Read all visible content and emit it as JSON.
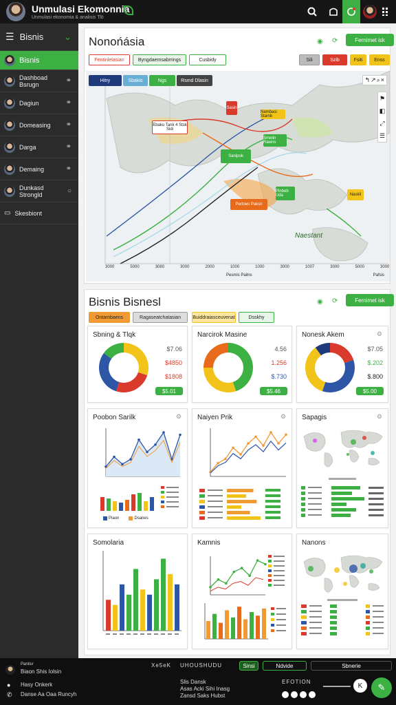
{
  "app": {
    "title": "Unmulasi Ekomonnia",
    "subtitle": "Unmulasi ekonomia & analisis Ti̇̇ö"
  },
  "colors": {
    "accent": "#3cb043",
    "dark": "#161616",
    "sidebar": "#2b2b2b",
    "red": "#d93a2b",
    "yellow": "#f2c318",
    "blue": "#2d56a6"
  },
  "topbar_icons": [
    "search-icon",
    "chat-icon",
    "refresh-icon",
    "avatar",
    "grid-icon"
  ],
  "sidebar": {
    "header": "Bisnis",
    "items": [
      {
        "label": "Bisnis",
        "active": true
      },
      {
        "label": "Dashboad Bsrugn"
      },
      {
        "label": "Dagiun"
      },
      {
        "label": "Domeasing"
      },
      {
        "label": "Darga"
      },
      {
        "label": "Demaing"
      },
      {
        "label": "Dunkasd Strongld"
      },
      {
        "label": "Skesbiont"
      }
    ]
  },
  "map_panel": {
    "title": "Nonońásia",
    "action": "Fernimet isk",
    "filters": [
      "Fentinlelasian",
      "Byngdaemsabrrings",
      "Cusbidy"
    ],
    "toggles": [
      "Hitry",
      "Sbakis",
      "Ngs",
      "Rsmd Dlasin"
    ],
    "buttons": [
      "Sili",
      "Szib",
      "Fsiti",
      "Enss"
    ],
    "callouts": [
      "Sasin",
      "Ebaku Tank 4 Stsk Sidi",
      "Nambasi Stamb",
      "Smelin Rawns",
      "Sanipok",
      "Pertoes Paksir",
      "Pinbeb Uda",
      "Naskil"
    ],
    "region_label": "Naestant",
    "x_ticks": [
      "3000",
      "5000",
      "3080",
      "3000",
      "2000",
      "1000",
      "1000",
      "3000",
      "1007",
      "3000",
      "5000",
      "3000"
    ],
    "x_label": "Pesmis Pailns",
    "x_unit": "Pafsis"
  },
  "business_panel": {
    "title": "Bisnis Bisnesl",
    "action": "Fernimet isk",
    "filters": [
      "Ontambaens",
      "Ragaseatchatasian",
      "Buiddraiasceuvenat",
      "Dsskhy"
    ]
  },
  "charts": [
    {
      "title": "Sbning & Tlqk",
      "type": "donut",
      "values": [
        "$7.06",
        "$4850",
        "$1808"
      ],
      "badge": "$5.01",
      "chart_data": {
        "type": "pie",
        "values": [
          30,
          25,
          30,
          15
        ],
        "colors": [
          "#f2c318",
          "#d93a2b",
          "#2d56a6",
          "#3cb043"
        ]
      }
    },
    {
      "title": "Narcirok Masine",
      "type": "donut",
      "values": [
        "4.56",
        "1.256",
        "$.730"
      ],
      "badge": "$5.46",
      "chart_data": {
        "type": "pie",
        "values": [
          45,
          30,
          25
        ],
        "colors": [
          "#3cb043",
          "#f2c318",
          "#e86a1b"
        ]
      }
    },
    {
      "title": "Nonesk Akem",
      "type": "donut",
      "values": [
        "$7.05",
        "$.202",
        "$.800"
      ],
      "badge": "$5.00",
      "chart_data": {
        "type": "pie",
        "values": [
          20,
          35,
          35,
          10
        ],
        "colors": [
          "#d93a2b",
          "#2d56a6",
          "#f2c318",
          "#1f3a7a"
        ]
      }
    },
    {
      "title": "Poobon Sarilk",
      "type": "line",
      "legend": [
        "Piaon",
        "Dsanes"
      ],
      "chart_data": {
        "type": "line",
        "y": [
          2,
          4,
          2.5,
          3.5,
          7.5,
          5,
          6.5,
          9,
          3.5,
          8.5
        ]
      },
      "bars": [
        20,
        18,
        14,
        12,
        16,
        24,
        26,
        14,
        20
      ]
    },
    {
      "title": "Naiyen Prik",
      "type": "line",
      "chart_data": {
        "type": "line",
        "y": [
          1,
          3,
          4,
          6.5,
          5,
          7.5,
          9,
          7,
          10,
          7.5,
          9.5
        ]
      },
      "hbars": [
        55,
        40,
        62,
        30,
        48,
        70
      ]
    },
    {
      "title": "Sapagis",
      "type": "map",
      "hbars": [
        42,
        30,
        48,
        22,
        36,
        28
      ]
    },
    {
      "title": "Somolaria",
      "type": "bar",
      "chart_data": {
        "type": "bar",
        "values": [
          6,
          5,
          9,
          7,
          12,
          8,
          7,
          10,
          14,
          11,
          9
        ],
        "ylim": [
          0,
          15
        ]
      }
    },
    {
      "title": "Kamnis",
      "type": "line",
      "chart_data": {
        "type": "line",
        "y": [
          2,
          4,
          3,
          6,
          7,
          5,
          9,
          8
        ]
      },
      "bars": [
        10,
        14,
        9,
        16,
        12,
        18,
        11,
        15,
        13,
        17
      ]
    },
    {
      "title": "Nanons",
      "type": "map"
    }
  ],
  "footer": {
    "left": [
      "Pantisr",
      "Biaon Shis Iolsin",
      "Hasy Onkerk",
      "Danse Aa Oaa Runcyh"
    ],
    "mid_head": [
      "Xe5eK",
      "UHOUSHUDU"
    ],
    "mid": [
      "Slis Dansk",
      "Asas Acki Sihi Inasg",
      "Zansd Saks Hubst"
    ],
    "buttons": [
      "Sinsi",
      "Ndvide",
      "Sbnerie"
    ],
    "right_label": "EFOTION"
  }
}
